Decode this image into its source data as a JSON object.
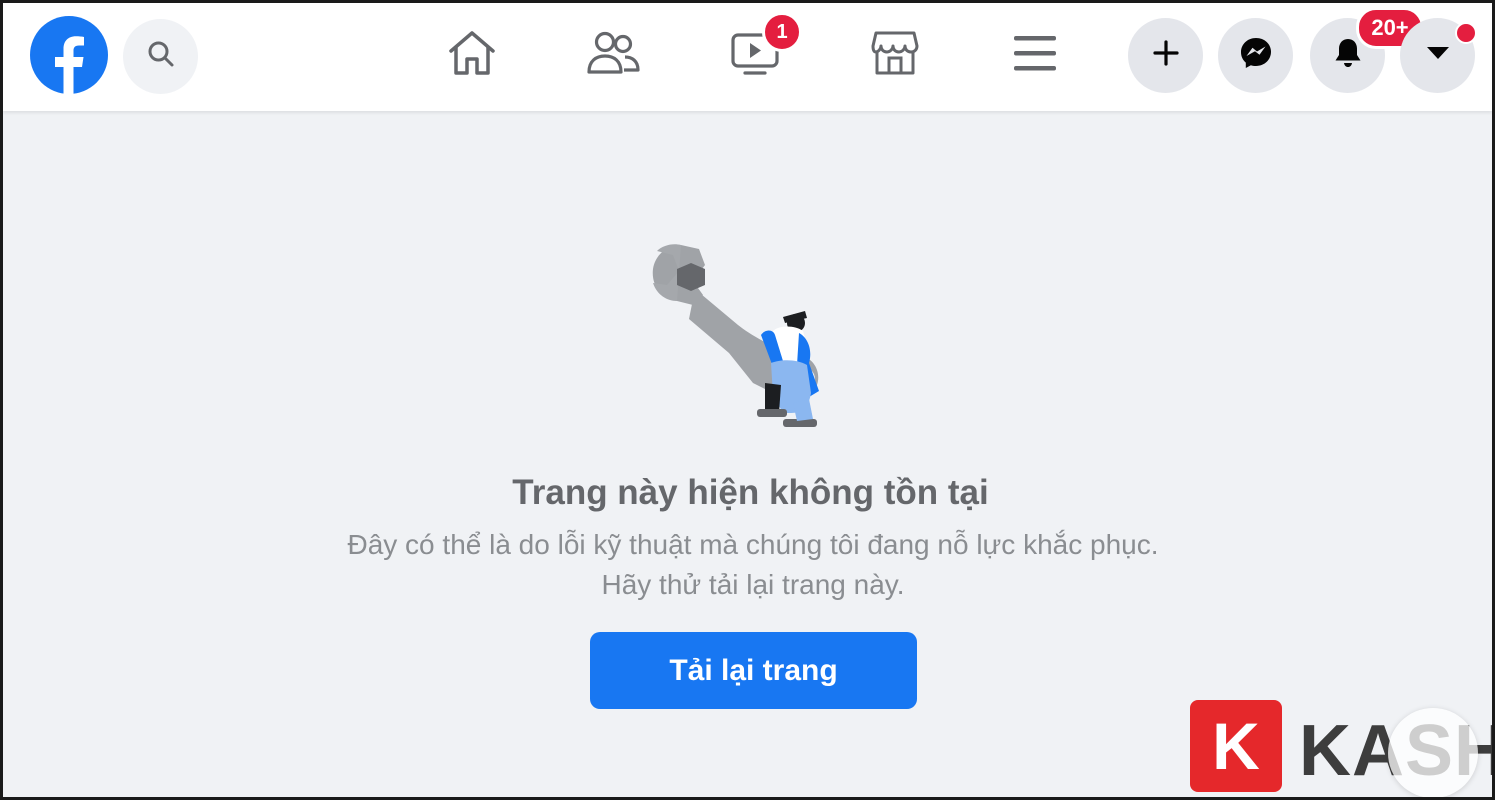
{
  "header": {
    "notifications": {
      "watch_count": "1",
      "bell_count": "20+"
    }
  },
  "icons": {
    "logo": "facebook-logo",
    "search": "search-icon",
    "home": "home-icon",
    "friends": "friends-icon",
    "watch": "watch-icon",
    "marketplace": "marketplace-icon",
    "menu": "menu-icon",
    "create": "plus-icon",
    "messenger": "messenger-icon",
    "notifications": "bell-icon",
    "account": "caret-down-icon"
  },
  "colors": {
    "brand": "#1877f2",
    "badge": "#e41e3f",
    "background": "#f0f2f5"
  },
  "main": {
    "title": "Trang này hiện không tồn tại",
    "description": "Đây có thể là do lỗi kỹ thuật mà chúng tôi đang nỗ lực khắc phục. Hãy thử tải lại trang này.",
    "reload_label": "Tải lại trang"
  },
  "watermark": {
    "letter": "K",
    "text": "KASHI"
  }
}
